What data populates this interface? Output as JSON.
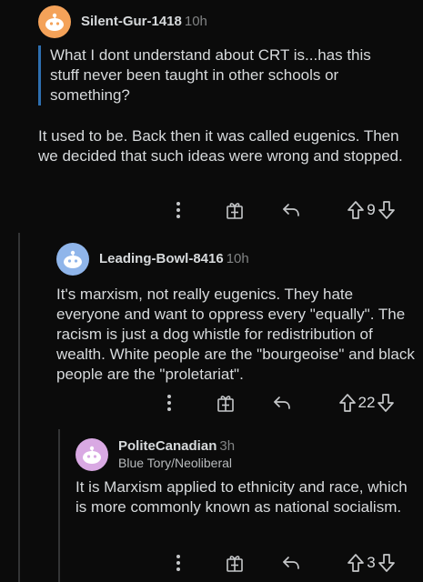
{
  "comments": [
    {
      "username": "Silent-Gur-1418",
      "age": "10h",
      "flair": "",
      "avatar_color": "#f4a259",
      "quote": "What I dont understand about CRT is...has this stuff never been taught in other schools or something?",
      "body": "It used to be.  Back then it was called eugenics. Then we decided that such ideas were wrong and stopped.",
      "score": "9"
    },
    {
      "username": "Leading-Bowl-8416",
      "age": "10h",
      "flair": "",
      "avatar_color": "#8fb5ea",
      "body": "It's marxism, not really eugenics. They hate everyone and want to oppress every \"equally\". The racism is just a dog whistle for redistribution of wealth. White people are the \"bourgeoise\" and black people are the \"proletariat\".",
      "score": "22"
    },
    {
      "username": "PoliteCanadian",
      "age": "3h",
      "flair": "Blue Tory/Neoliberal",
      "avatar_color": "#d9a9e3",
      "body": "It is Marxism applied to ethnicity and race, which is more commonly known as national socialism.",
      "score": "3"
    }
  ],
  "colors": {
    "background": "#0b0b0b",
    "text": "#d7dadc",
    "muted": "#818384",
    "quote_bar": "#2e6fb0",
    "thread_line": "#343536"
  },
  "icons": {
    "more": "more-vertical-icon",
    "award": "gift-award-icon",
    "reply": "reply-arrow-icon",
    "upvote": "upvote-arrow-icon",
    "downvote": "downvote-arrow-icon"
  }
}
